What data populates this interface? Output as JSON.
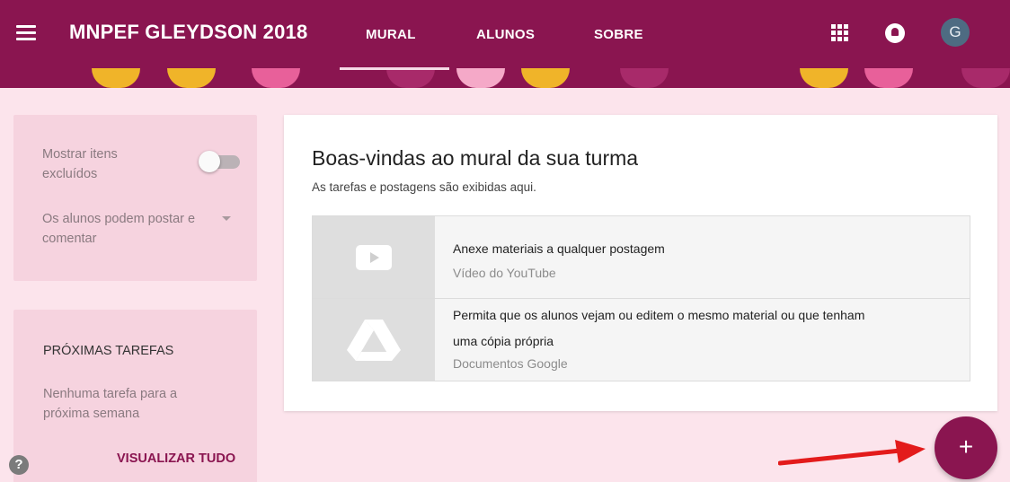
{
  "header": {
    "class_name": "MNPEF GLEYDSON 2018",
    "tabs": [
      {
        "label": "MURAL",
        "active": true
      },
      {
        "label": "ALUNOS",
        "active": false
      },
      {
        "label": "SOBRE",
        "active": false
      }
    ],
    "avatar_initial": "G",
    "icons": [
      "menu-icon",
      "apps-grid-icon",
      "notifications-icon"
    ]
  },
  "settings": {
    "show_deleted_label": "Mostrar itens excluídos",
    "show_deleted_enabled": false,
    "student_permission": "Os alunos podem postar e comentar"
  },
  "upcoming": {
    "title": "PRÓXIMAS TAREFAS",
    "empty_text": "Nenhuma tarefa para a próxima semana",
    "view_all": "VISUALIZAR TUDO"
  },
  "welcome": {
    "title": "Boas-vindas ao mural da sua turma",
    "subtitle": "As tarefas e postagens são exibidas aqui.",
    "items": [
      {
        "title": "Anexe materiais a qualquer postagem",
        "subtitle": "Vídeo do YouTube",
        "icon": "youtube-icon"
      },
      {
        "title_line1": "Permita que os alunos vejam ou editem o mesmo material ou que tenham",
        "title_line2": "uma cópia própria",
        "subtitle": "Documentos Google",
        "icon": "google-drive-icon"
      }
    ]
  },
  "fab_symbol": "+",
  "colors": {
    "primary": "#8a1550",
    "background": "#fce4ec",
    "panel": "#f6d3df"
  }
}
